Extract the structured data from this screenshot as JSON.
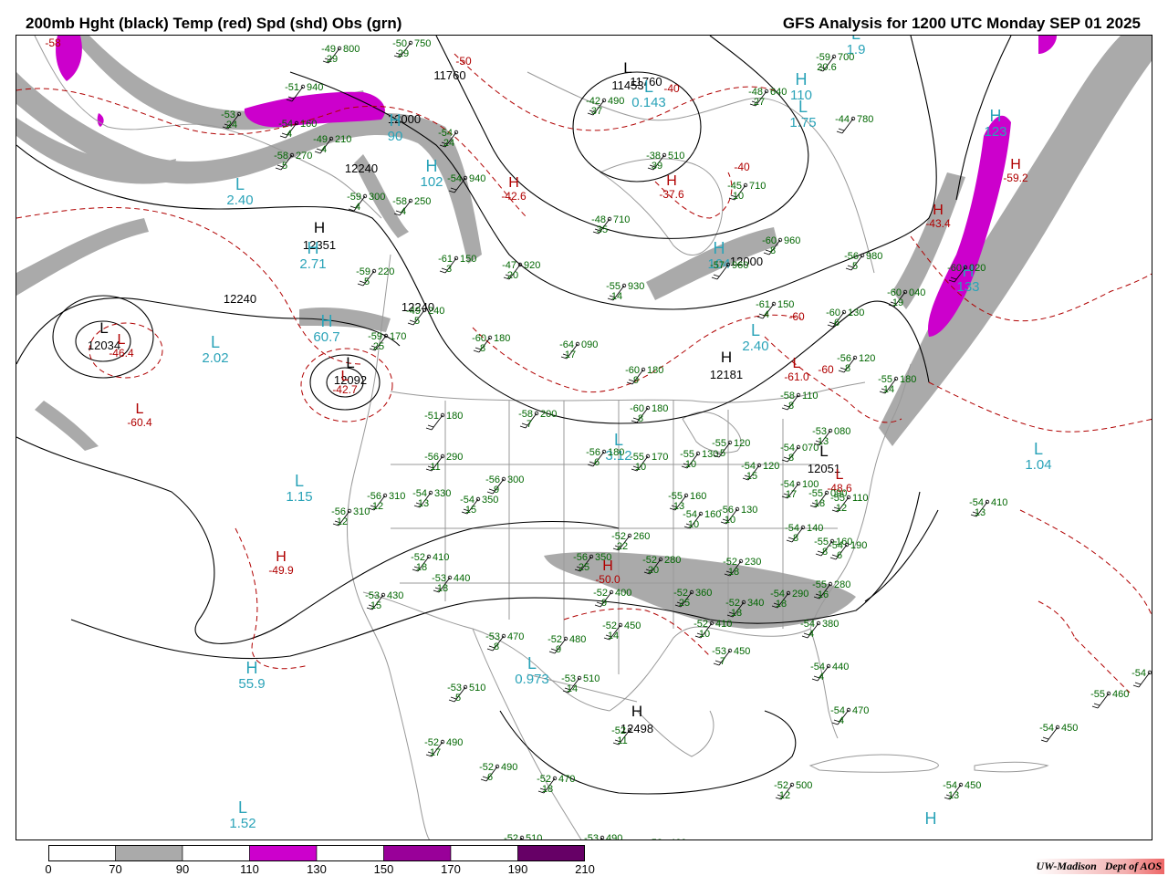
{
  "header": {
    "title_left": "200mb Hght (black) Temp (red) Spd (shd) Obs (grn)",
    "title_right": "GFS Analysis for 1200 UTC Monday  SEP 01 2025"
  },
  "scale": {
    "labels": [
      "0",
      "70",
      "90",
      "110",
      "130",
      "150",
      "170",
      "190",
      "210"
    ],
    "segments": [
      {
        "from": "0",
        "to": "70",
        "color": "#ffffff"
      },
      {
        "from": "70",
        "to": "90",
        "color": "#aaaaaa"
      },
      {
        "from": "90",
        "to": "110",
        "color": "#ffffff"
      },
      {
        "from": "110",
        "to": "130",
        "color": "#cc00cc"
      },
      {
        "from": "130",
        "to": "150",
        "color": "#ffffff"
      },
      {
        "from": "150",
        "to": "170",
        "color": "#990099"
      },
      {
        "from": "170",
        "to": "190",
        "color": "#ffffff"
      },
      {
        "from": "190",
        "to": "210",
        "color": "#660066"
      }
    ]
  },
  "credit": {
    "org": "UW-Madison",
    "dept": "Dept of AOS"
  },
  "colors": {
    "height": "#000000",
    "temp": "#b00000",
    "speed_low": "#aaaaaa",
    "speed_high": "#cc00cc",
    "obs": "#006600",
    "cyan": "#2aa3b8",
    "borders": "#999999"
  },
  "height_centers": [
    {
      "type": "H",
      "value": "12351"
    },
    {
      "type": "L",
      "value": "12034"
    },
    {
      "type": "L",
      "value": "12092"
    },
    {
      "type": "L",
      "value": "11453"
    },
    {
      "type": "H",
      "value": "12181"
    },
    {
      "type": "H",
      "value": "12498"
    },
    {
      "type": "L",
      "value": "12051"
    }
  ],
  "contour_labels": [
    "11760",
    "12000",
    "12240",
    "12240",
    "12240",
    "11760",
    "12000"
  ],
  "temp_centers": [
    {
      "type": "L",
      "value": "-46.4"
    },
    {
      "type": "L",
      "value": "-42.7"
    },
    {
      "type": "H",
      "value": "-42.6"
    },
    {
      "type": "H",
      "value": "-37.6"
    },
    {
      "type": "L",
      "value": "-61.0"
    },
    {
      "type": "H",
      "value": "-43.4"
    },
    {
      "type": "H",
      "value": "-49.9"
    },
    {
      "type": "H",
      "value": "-50.0"
    },
    {
      "type": "L",
      "value": "-60.4"
    },
    {
      "type": "H",
      "value": "-59.2"
    },
    {
      "type": "L",
      "value": "-48.6"
    }
  ],
  "temp_labels": [
    "-50",
    "-40",
    "-40",
    "-60",
    "-60",
    "-58"
  ],
  "speed_centers": [
    {
      "type": "L",
      "value": "2.40"
    },
    {
      "type": "H",
      "value": "2.71"
    },
    {
      "type": "L",
      "value": "2.02"
    },
    {
      "type": "H",
      "value": "60.7"
    },
    {
      "type": "L",
      "value": "1.15"
    },
    {
      "type": "H",
      "value": "55.9"
    },
    {
      "type": "L",
      "value": "1.52"
    },
    {
      "type": "L",
      "value": "0.973"
    },
    {
      "type": "L",
      "value": "3.12"
    },
    {
      "type": "L",
      "value": "2.40"
    },
    {
      "type": "L",
      "value": "1.75"
    },
    {
      "type": "L",
      "value": "1.04"
    },
    {
      "type": "H",
      "value": "123"
    },
    {
      "type": "H",
      "value": "133"
    },
    {
      "type": "H",
      "value": "102"
    },
    {
      "type": "L",
      "value": "0.143"
    },
    {
      "type": "H",
      "value": "104"
    },
    {
      "type": "H",
      "value": "110"
    },
    {
      "type": "L",
      "value": "1.9"
    },
    {
      "type": "H",
      "value": "90"
    },
    {
      "type": "H",
      "value": "H"
    }
  ],
  "observations": [
    {
      "temp": "-49",
      "hgt": "800",
      "spd": "29"
    },
    {
      "temp": "-50",
      "hgt": "750",
      "spd": "29"
    },
    {
      "temp": "-51",
      "hgt": "940",
      "spd": ""
    },
    {
      "temp": "-53",
      "hgt": "",
      "spd": "24"
    },
    {
      "temp": "-54",
      "hgt": "160",
      "spd": "4"
    },
    {
      "temp": "-49",
      "hgt": "210",
      "spd": "4"
    },
    {
      "temp": "-58",
      "hgt": "270",
      "spd": "5"
    },
    {
      "temp": "-54",
      "hgt": "",
      "spd": "24"
    },
    {
      "temp": "-42",
      "hgt": "490",
      "spd": "37"
    },
    {
      "temp": "-54",
      "hgt": "940",
      "spd": ""
    },
    {
      "temp": "-59",
      "hgt": "300",
      "spd": "4"
    },
    {
      "temp": "-58",
      "hgt": "250",
      "spd": "4"
    },
    {
      "temp": "-38",
      "hgt": "510",
      "spd": "39"
    },
    {
      "temp": "-48",
      "hgt": "710",
      "spd": "35"
    },
    {
      "temp": "-45",
      "hgt": "710",
      "spd": "10"
    },
    {
      "temp": "-48",
      "hgt": "640",
      "spd": "27"
    },
    {
      "temp": "-59",
      "hgt": "700",
      "spd": "20.6"
    },
    {
      "temp": "-44",
      "hgt": "780",
      "spd": ""
    },
    {
      "temp": "-59",
      "hgt": "220",
      "spd": "5"
    },
    {
      "temp": "-61",
      "hgt": "150",
      "spd": "3"
    },
    {
      "temp": "-47",
      "hgt": "920",
      "spd": "20"
    },
    {
      "temp": "-57",
      "hgt": "960",
      "spd": ""
    },
    {
      "temp": "-60",
      "hgt": "960",
      "spd": "8"
    },
    {
      "temp": "-56",
      "hgt": "980",
      "spd": "5"
    },
    {
      "temp": "-55",
      "hgt": "930",
      "spd": "14"
    },
    {
      "temp": "-49",
      "hgt": "240",
      "spd": "5"
    },
    {
      "temp": "-60",
      "hgt": "180",
      "spd": "8"
    },
    {
      "temp": "-59",
      "hgt": "170",
      "spd": "25"
    },
    {
      "temp": "-64",
      "hgt": "090",
      "spd": "17"
    },
    {
      "temp": "-61",
      "hgt": "150",
      "spd": "4"
    },
    {
      "temp": "-60",
      "hgt": "130",
      "spd": "6"
    },
    {
      "temp": "-56",
      "hgt": "120",
      "spd": "8"
    },
    {
      "temp": "-55",
      "hgt": "180",
      "spd": "14"
    },
    {
      "temp": "-58",
      "hgt": "110",
      "spd": "8"
    },
    {
      "temp": "-60",
      "hgt": "040",
      "spd": "19"
    },
    {
      "temp": "-60",
      "hgt": "020",
      "spd": ""
    },
    {
      "temp": "-60",
      "hgt": "180",
      "spd": "9"
    },
    {
      "temp": "-51",
      "hgt": "180",
      "spd": ""
    },
    {
      "temp": "-58",
      "hgt": "200",
      "spd": "7"
    },
    {
      "temp": "-60",
      "hgt": "180",
      "spd": "8"
    },
    {
      "temp": "-56",
      "hgt": "180",
      "spd": "6"
    },
    {
      "temp": "-55",
      "hgt": "170",
      "spd": "10"
    },
    {
      "temp": "-55",
      "hgt": "130",
      "spd": "10"
    },
    {
      "temp": "-55",
      "hgt": "120",
      "spd": "5"
    },
    {
      "temp": "-54",
      "hgt": "120",
      "spd": "15"
    },
    {
      "temp": "-54",
      "hgt": "070",
      "spd": "8"
    },
    {
      "temp": "-53",
      "hgt": "080",
      "spd": "13"
    },
    {
      "temp": "-56",
      "hgt": "290",
      "spd": "11"
    },
    {
      "temp": "-56",
      "hgt": "300",
      "spd": "9"
    },
    {
      "temp": "-56",
      "hgt": "310",
      "spd": "12"
    },
    {
      "temp": "-54",
      "hgt": "330",
      "spd": "13"
    },
    {
      "temp": "-54",
      "hgt": "350",
      "spd": "15"
    },
    {
      "temp": "-56",
      "hgt": "310",
      "spd": "12"
    },
    {
      "temp": "-55",
      "hgt": "160",
      "spd": "13"
    },
    {
      "temp": "-54",
      "hgt": "160",
      "spd": "10"
    },
    {
      "temp": "-56",
      "hgt": "130",
      "spd": "10"
    },
    {
      "temp": "-54",
      "hgt": "100",
      "spd": "17"
    },
    {
      "temp": "-55",
      "hgt": "090",
      "spd": "18"
    },
    {
      "temp": "-55",
      "hgt": "110",
      "spd": "12"
    },
    {
      "temp": "-54",
      "hgt": "140",
      "spd": "8"
    },
    {
      "temp": "-55",
      "hgt": "160",
      "spd": "8"
    },
    {
      "temp": "-54",
      "hgt": "190",
      "spd": "6"
    },
    {
      "temp": "-54",
      "hgt": "410",
      "spd": "13"
    },
    {
      "temp": "-52",
      "hgt": "260",
      "spd": "22"
    },
    {
      "temp": "-56",
      "hgt": "350",
      "spd": "25"
    },
    {
      "temp": "-52",
      "hgt": "280",
      "spd": "20"
    },
    {
      "temp": "-52",
      "hgt": "230",
      "spd": "18"
    },
    {
      "temp": "-52",
      "hgt": "410",
      "spd": "18"
    },
    {
      "temp": "-53",
      "hgt": "440",
      "spd": "18"
    },
    {
      "temp": "-53",
      "hgt": "430",
      "spd": "15"
    },
    {
      "temp": "-52",
      "hgt": "400",
      "spd": "9"
    },
    {
      "temp": "-52",
      "hgt": "360",
      "spd": "25"
    },
    {
      "temp": "-52",
      "hgt": "340",
      "spd": "18"
    },
    {
      "temp": "-54",
      "hgt": "290",
      "spd": "18"
    },
    {
      "temp": "-55",
      "hgt": "280",
      "spd": "16"
    },
    {
      "temp": "-52",
      "hgt": "450",
      "spd": "14"
    },
    {
      "temp": "-52",
      "hgt": "410",
      "spd": "10"
    },
    {
      "temp": "-53",
      "hgt": "450",
      "spd": "7"
    },
    {
      "temp": "-54",
      "hgt": "380",
      "spd": "4"
    },
    {
      "temp": "-53",
      "hgt": "470",
      "spd": "8"
    },
    {
      "temp": "-52",
      "hgt": "480",
      "spd": "9"
    },
    {
      "temp": "-54",
      "hgt": "440",
      "spd": "4"
    },
    {
      "temp": "-53",
      "hgt": "510",
      "spd": "5"
    },
    {
      "temp": "-53",
      "hgt": "510",
      "spd": "14"
    },
    {
      "temp": "-54",
      "hgt": "470",
      "spd": "4"
    },
    {
      "temp": "-52",
      "hgt": "490",
      "spd": "17"
    },
    {
      "temp": "-52",
      "hgt": "",
      "spd": "11"
    },
    {
      "temp": "-52",
      "hgt": "490",
      "spd": "6"
    },
    {
      "temp": "-52",
      "hgt": "470",
      "spd": "18"
    },
    {
      "temp": "-52",
      "hgt": "500",
      "spd": "12"
    },
    {
      "temp": "-54",
      "hgt": "450",
      "spd": "13"
    },
    {
      "temp": "-55",
      "hgt": "460",
      "spd": ""
    },
    {
      "temp": "-54",
      "hgt": "450",
      "spd": ""
    },
    {
      "temp": "-54",
      "hgt": "",
      "spd": ""
    },
    {
      "temp": "-52",
      "hgt": "510",
      "spd": ""
    },
    {
      "temp": "-53",
      "hgt": "490",
      "spd": ""
    },
    {
      "temp": "-53",
      "hgt": "460",
      "spd": ""
    }
  ]
}
